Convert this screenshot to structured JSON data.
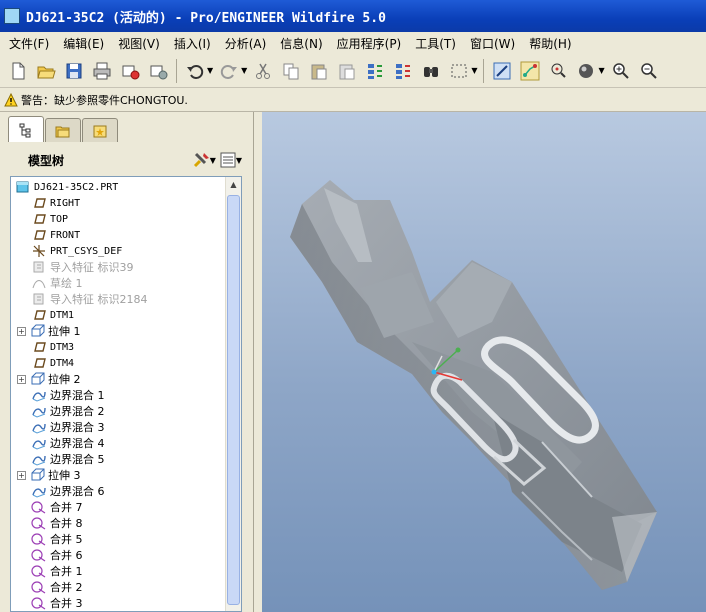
{
  "window": {
    "title": "DJ621-35C2 (活动的) - Pro/ENGINEER Wildfire 5.0"
  },
  "menu": [
    {
      "label": "文件(F)",
      "name": "menu-file"
    },
    {
      "label": "编辑(E)",
      "name": "menu-edit"
    },
    {
      "label": "视图(V)",
      "name": "menu-view"
    },
    {
      "label": "插入(I)",
      "name": "menu-insert"
    },
    {
      "label": "分析(A)",
      "name": "menu-analysis"
    },
    {
      "label": "信息(N)",
      "name": "menu-info"
    },
    {
      "label": "应用程序(P)",
      "name": "menu-applications"
    },
    {
      "label": "工具(T)",
      "name": "menu-tools"
    },
    {
      "label": "窗口(W)",
      "name": "menu-window"
    },
    {
      "label": "帮助(H)",
      "name": "menu-help"
    }
  ],
  "warning": {
    "message": "警告：缺少参照零件CHONGTOU."
  },
  "panel": {
    "title": "模型树"
  },
  "tree": [
    {
      "label": "DJ621-35C2.PRT",
      "icon": "part-icon",
      "indent": 0,
      "expander": false,
      "dim": false,
      "cn": false
    },
    {
      "label": "RIGHT",
      "icon": "datum-plane-icon",
      "indent": 1,
      "expander": false,
      "dim": false,
      "cn": false
    },
    {
      "label": "TOP",
      "icon": "datum-plane-icon",
      "indent": 1,
      "expander": false,
      "dim": false,
      "cn": false
    },
    {
      "label": "FRONT",
      "icon": "datum-plane-icon",
      "indent": 1,
      "expander": false,
      "dim": false,
      "cn": false
    },
    {
      "label": "PRT_CSYS_DEF",
      "icon": "csys-icon",
      "indent": 1,
      "expander": false,
      "dim": false,
      "cn": false
    },
    {
      "label": "导入特征 标识39",
      "icon": "import-feature-icon",
      "indent": 1,
      "expander": false,
      "dim": true,
      "cn": true
    },
    {
      "label": "草绘 1",
      "icon": "sketch-icon",
      "indent": 1,
      "expander": false,
      "dim": true,
      "cn": true
    },
    {
      "label": "导入特征 标识2184",
      "icon": "import-feature-icon",
      "indent": 1,
      "expander": false,
      "dim": true,
      "cn": true
    },
    {
      "label": "DTM1",
      "icon": "datum-plane-icon",
      "indent": 1,
      "expander": false,
      "dim": false,
      "cn": false
    },
    {
      "label": "拉伸 1",
      "icon": "extrude-icon",
      "indent": 1,
      "expander": true,
      "dim": false,
      "cn": true
    },
    {
      "label": "DTM3",
      "icon": "datum-plane-icon",
      "indent": 1,
      "expander": false,
      "dim": false,
      "cn": false
    },
    {
      "label": "DTM4",
      "icon": "datum-plane-icon",
      "indent": 1,
      "expander": false,
      "dim": false,
      "cn": false
    },
    {
      "label": "拉伸 2",
      "icon": "extrude-icon",
      "indent": 1,
      "expander": true,
      "dim": false,
      "cn": true
    },
    {
      "label": "边界混合 1",
      "icon": "boundary-blend-icon",
      "indent": 1,
      "expander": false,
      "dim": false,
      "cn": true
    },
    {
      "label": "边界混合 2",
      "icon": "boundary-blend-icon",
      "indent": 1,
      "expander": false,
      "dim": false,
      "cn": true
    },
    {
      "label": "边界混合 3",
      "icon": "boundary-blend-icon",
      "indent": 1,
      "expander": false,
      "dim": false,
      "cn": true
    },
    {
      "label": "边界混合 4",
      "icon": "boundary-blend-icon",
      "indent": 1,
      "expander": false,
      "dim": false,
      "cn": true
    },
    {
      "label": "边界混合 5",
      "icon": "boundary-blend-icon",
      "indent": 1,
      "expander": false,
      "dim": false,
      "cn": true
    },
    {
      "label": "拉伸 3",
      "icon": "extrude-icon",
      "indent": 1,
      "expander": true,
      "dim": false,
      "cn": true
    },
    {
      "label": "边界混合 6",
      "icon": "boundary-blend-icon",
      "indent": 1,
      "expander": false,
      "dim": false,
      "cn": true
    },
    {
      "label": "合并 7",
      "icon": "merge-icon",
      "indent": 1,
      "expander": false,
      "dim": false,
      "cn": true
    },
    {
      "label": "合并 8",
      "icon": "merge-icon",
      "indent": 1,
      "expander": false,
      "dim": false,
      "cn": true
    },
    {
      "label": "合并 5",
      "icon": "merge-icon",
      "indent": 1,
      "expander": false,
      "dim": false,
      "cn": true
    },
    {
      "label": "合并 6",
      "icon": "merge-icon",
      "indent": 1,
      "expander": false,
      "dim": false,
      "cn": true
    },
    {
      "label": "合并 1",
      "icon": "merge-icon",
      "indent": 1,
      "expander": false,
      "dim": false,
      "cn": true
    },
    {
      "label": "合并 2",
      "icon": "merge-icon",
      "indent": 1,
      "expander": false,
      "dim": false,
      "cn": true
    },
    {
      "label": "合并 3",
      "icon": "merge-icon",
      "indent": 1,
      "expander": false,
      "dim": false,
      "cn": true
    }
  ],
  "colors": {
    "title_bar": "#0a3fb8",
    "viewport_top": "#b8c9e0",
    "viewport_bottom": "#7592b9",
    "model": "#8e959d"
  }
}
